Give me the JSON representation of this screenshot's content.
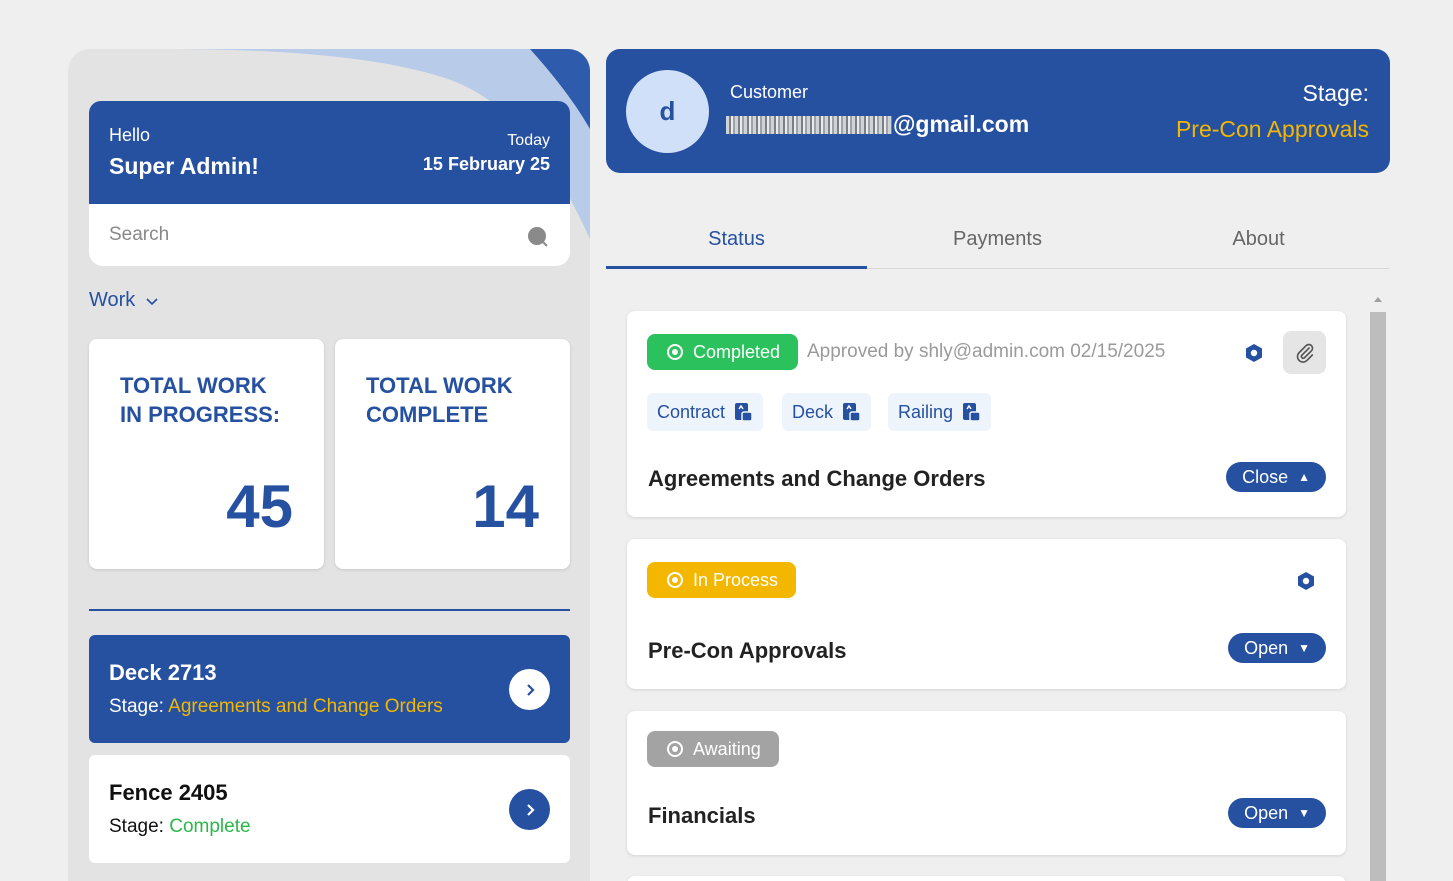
{
  "colors": {
    "primary": "#2650a0",
    "accent": "#f3b700",
    "success": "#2bc25e",
    "complete_text": "#2bb74a",
    "muted": "#a3a3a3"
  },
  "greeting": {
    "hello": "Hello",
    "name": "Super Admin!",
    "today_label": "Today",
    "date": "15 February 25"
  },
  "search": {
    "placeholder": "Search",
    "icon": "search-icon"
  },
  "filter": {
    "label": "Work",
    "icon": "chevron-down-icon"
  },
  "stats": [
    {
      "label": "TOTAL WORK IN PROGRESS:",
      "value": "45"
    },
    {
      "label": "TOTAL WORK COMPLETE",
      "value": "14"
    }
  ],
  "projects": [
    {
      "title": "Deck 2713",
      "stage_label": "Stage:",
      "stage_value": "Agreements and Change Orders",
      "selected": true
    },
    {
      "title": "Fence 2405",
      "stage_label": "Stage:",
      "stage_value": "Complete",
      "selected": false
    }
  ],
  "customer": {
    "avatar_letter": "d",
    "label": "Customer",
    "email_suffix": "@gmail.com",
    "stage_label": "Stage:",
    "stage_value": "Pre-Con Approvals"
  },
  "tabs": [
    {
      "label": "Status",
      "active": true
    },
    {
      "label": "Payments",
      "active": false
    },
    {
      "label": "About",
      "active": false
    }
  ],
  "stages": [
    {
      "badge": "Completed",
      "approved_text": "Approved by shly@admin.com 02/15/2025",
      "documents": [
        "Contract",
        "Deck",
        "Railing"
      ],
      "title": "Agreements and Change Orders",
      "toggle_label": "Close",
      "toggle_caret": "▲"
    },
    {
      "badge": "In Process",
      "title": "Pre-Con Approvals",
      "toggle_label": "Open",
      "toggle_caret": "▼"
    },
    {
      "badge": "Awaiting",
      "title": "Financials",
      "toggle_label": "Open",
      "toggle_caret": "▼"
    }
  ]
}
